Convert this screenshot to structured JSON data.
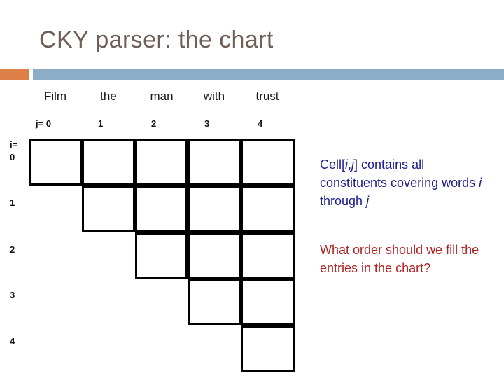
{
  "slide": {
    "title": "CKY parser: the chart",
    "accent_orange": "#DD8047",
    "accent_blue": "#8CACC8",
    "title_color": "#6E5F57"
  },
  "chart_data": {
    "type": "table",
    "title": "CKY parser: the chart",
    "sentence": [
      "Film",
      "the",
      "man",
      "with",
      "trust"
    ],
    "column_index_prefix": "j=",
    "column_indices": [
      "0",
      "1",
      "2",
      "3",
      "4"
    ],
    "row_index_prefix": "i=",
    "row_indices": [
      "0",
      "1",
      "2",
      "3",
      "4"
    ],
    "shape": "upper-triangular",
    "cells_per_row": [
      5,
      4,
      3,
      2,
      1
    ],
    "cells": [
      {
        "i": 0,
        "j": 0,
        "value": ""
      },
      {
        "i": 0,
        "j": 1,
        "value": ""
      },
      {
        "i": 0,
        "j": 2,
        "value": ""
      },
      {
        "i": 0,
        "j": 3,
        "value": ""
      },
      {
        "i": 0,
        "j": 4,
        "value": ""
      },
      {
        "i": 1,
        "j": 1,
        "value": ""
      },
      {
        "i": 1,
        "j": 2,
        "value": ""
      },
      {
        "i": 1,
        "j": 3,
        "value": ""
      },
      {
        "i": 1,
        "j": 4,
        "value": ""
      },
      {
        "i": 2,
        "j": 2,
        "value": ""
      },
      {
        "i": 2,
        "j": 3,
        "value": ""
      },
      {
        "i": 2,
        "j": 4,
        "value": ""
      },
      {
        "i": 3,
        "j": 3,
        "value": ""
      },
      {
        "i": 3,
        "j": 4,
        "value": ""
      },
      {
        "i": 4,
        "j": 4,
        "value": ""
      }
    ],
    "grid_color": "#000000",
    "grid": true,
    "xlabel": "j",
    "ylabel": "i"
  },
  "header": {
    "words": [
      {
        "text": "Film"
      },
      {
        "text": "the"
      },
      {
        "text": "man"
      },
      {
        "text": "with"
      },
      {
        "text": "trust"
      }
    ],
    "j_labels": [
      "j= 0",
      "1",
      "2",
      "3",
      "4"
    ]
  },
  "rows": {
    "i_eq": "i=",
    "labels": [
      "0",
      "1",
      "2",
      "3",
      "4"
    ]
  },
  "callouts": {
    "cell_definition": {
      "text": "Cell[i,j] contains all constituents covering words i through j",
      "color": "#1C1C8E",
      "line1_a": "Cell[",
      "line1_i": "i",
      "line1_comma": ",",
      "line1_j": "j",
      "line1_b": "] contains all",
      "line2": "constituents covering",
      "line3_a": "words ",
      "line3_i": "i",
      "line3_b": " through ",
      "line3_j": "j"
    },
    "fill_order": {
      "text": "What order should we fill the entries in the chart?",
      "color": "#B02222",
      "line1": "What order should we",
      "line2": "fill the entries in the",
      "line3": "chart?"
    }
  }
}
